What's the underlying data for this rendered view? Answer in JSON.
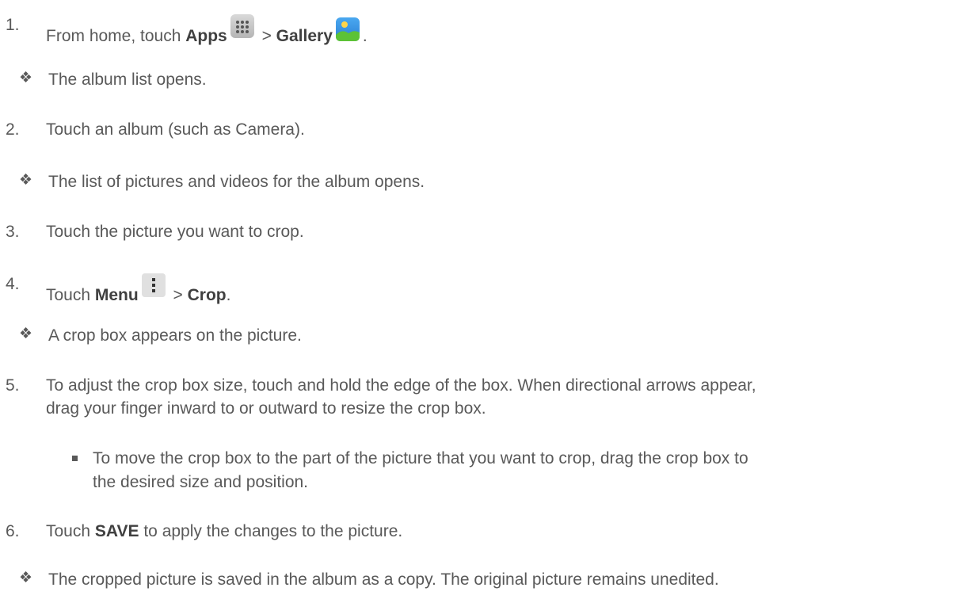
{
  "steps": [
    {
      "number": "1.",
      "prefix": "From home, touch ",
      "apps": "Apps",
      "sep": " > ",
      "gallery": "Gallery",
      "suffix": ".",
      "apps_icon": "apps-grid-icon",
      "gallery_icon": "gallery-icon",
      "result": "The album list opens."
    },
    {
      "number": "2.",
      "text": "Touch an album (such as Camera).",
      "result": "The list of pictures and videos for the album opens."
    },
    {
      "number": "3.",
      "text": "Touch the picture you want to crop."
    },
    {
      "number": "4.",
      "prefix": "Touch ",
      "menu": "Menu",
      "sep": " > ",
      "crop": "Crop",
      "suffix": ".",
      "menu_icon": "overflow-menu-icon",
      "result": "A crop box appears on the picture."
    },
    {
      "number": "5.",
      "text_line1": "To adjust the crop box size, touch and hold the edge of the box. When directional arrows appear,",
      "text_line2": "drag your finger inward to or outward to resize the crop box.",
      "sub_line1": "To move the crop box to the part of the picture that you want to crop, drag the crop box to",
      "sub_line2": "the desired size and position."
    },
    {
      "number": "6.",
      "prefix": "Touch ",
      "save": "SAVE",
      "suffix": " to apply the changes to the picture.",
      "result": "The cropped picture is saved in the album as a copy. The original picture remains unedited."
    }
  ],
  "bullet_glyph": "❖",
  "colors": {
    "text": "#595959",
    "bold": "#404040"
  }
}
